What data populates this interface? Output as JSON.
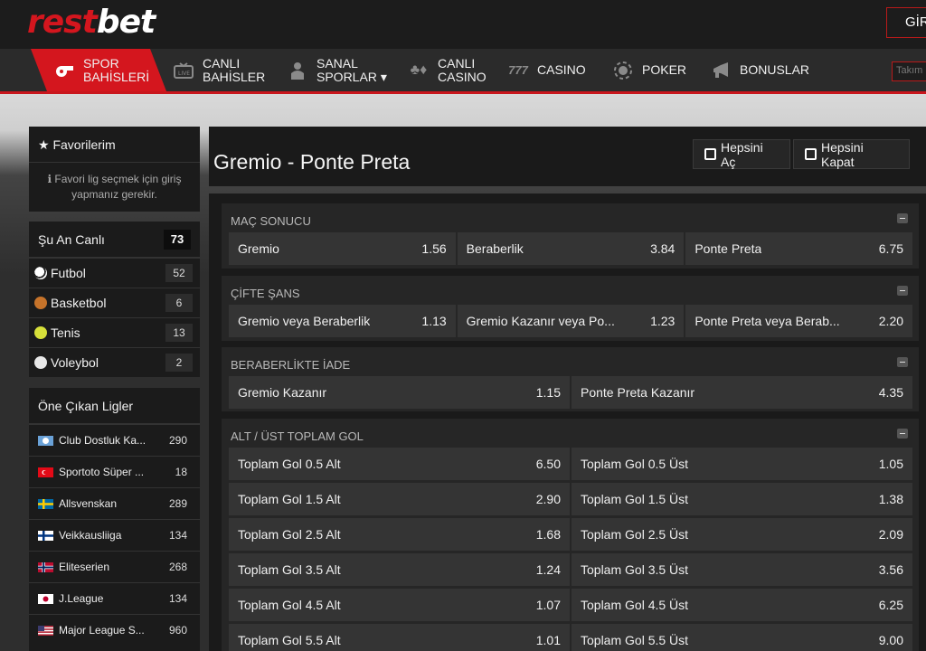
{
  "header": {
    "logo_rest": "rest",
    "logo_bet": "bet",
    "login_label": "GİRİ"
  },
  "nav": {
    "items": [
      {
        "line1": "SPOR",
        "line2": "BAHİSLERİ",
        "icon": "whistle-icon"
      },
      {
        "line1": "CANLI",
        "line2": "BAHİSLER",
        "icon": "live-tv-icon"
      },
      {
        "line1": "SANAL",
        "line2": "SPORLAR",
        "icon": "virtual-player-icon"
      },
      {
        "line1": "CANLI",
        "line2": "CASINO",
        "icon": "cards-icon"
      },
      {
        "line1": "CASINO",
        "line2": "",
        "icon": "slot-777-icon"
      },
      {
        "line1": "POKER",
        "line2": "",
        "icon": "poker-chip-icon"
      },
      {
        "line1": "BONUSLAR",
        "line2": "",
        "icon": "megaphone-icon"
      }
    ],
    "search_placeholder": "Takım"
  },
  "favorites": {
    "title": "★ Favorilerim",
    "note": "Favori lig seçmek için giriş yapmanız gerekir."
  },
  "live": {
    "title": "Şu An Canlı",
    "count": "73",
    "sports": [
      {
        "name": "Futbol",
        "count": "52"
      },
      {
        "name": "Basketbol",
        "count": "6"
      },
      {
        "name": "Tenis",
        "count": "13"
      },
      {
        "name": "Voleybol",
        "count": "2"
      }
    ]
  },
  "leagues": {
    "title": "Öne Çıkan Ligler",
    "items": [
      {
        "name": "Club Dostluk Ka...",
        "count": "290"
      },
      {
        "name": "Sportoto Süper ...",
        "count": "18"
      },
      {
        "name": "Allsvenskan",
        "count": "289"
      },
      {
        "name": "Veikkausliiga",
        "count": "134"
      },
      {
        "name": "Eliteserien",
        "count": "268"
      },
      {
        "name": "J.League",
        "count": "134"
      },
      {
        "name": "Major League S...",
        "count": "960"
      }
    ]
  },
  "match": {
    "title": "Gremio - Ponte Preta",
    "open_all": "Hepsini Aç",
    "close_all": "Hepsini Kapat"
  },
  "markets": [
    {
      "title": "MAÇ SONUCU",
      "rows": [
        [
          {
            "label": "Gremio",
            "odd": "1.56"
          },
          {
            "label": "Beraberlik",
            "odd": "3.84"
          },
          {
            "label": "Ponte Preta",
            "odd": "6.75"
          }
        ]
      ]
    },
    {
      "title": "ÇİFTE ŞANS",
      "rows": [
        [
          {
            "label": "Gremio veya Beraberlik",
            "odd": "1.13"
          },
          {
            "label": "Gremio Kazanır veya Po...",
            "odd": "1.23"
          },
          {
            "label": "Ponte Preta veya Berab...",
            "odd": "2.20"
          }
        ]
      ]
    },
    {
      "title": "BERABERLİKTE İADE",
      "rows": [
        [
          {
            "label": "Gremio Kazanır",
            "odd": "1.15"
          },
          {
            "label": "Ponte Preta Kazanır",
            "odd": "4.35"
          }
        ]
      ]
    },
    {
      "title": "ALT / ÜST TOPLAM GOL",
      "rows": [
        [
          {
            "label": "Toplam Gol 0.5 Alt",
            "odd": "6.50"
          },
          {
            "label": "Toplam Gol 0.5 Üst",
            "odd": "1.05"
          }
        ],
        [
          {
            "label": "Toplam Gol 1.5 Alt",
            "odd": "2.90"
          },
          {
            "label": "Toplam Gol 1.5 Üst",
            "odd": "1.38"
          }
        ],
        [
          {
            "label": "Toplam Gol 2.5 Alt",
            "odd": "1.68"
          },
          {
            "label": "Toplam Gol 2.5 Üst",
            "odd": "2.09"
          }
        ],
        [
          {
            "label": "Toplam Gol 3.5 Alt",
            "odd": "1.24"
          },
          {
            "label": "Toplam Gol 3.5 Üst",
            "odd": "3.56"
          }
        ],
        [
          {
            "label": "Toplam Gol 4.5 Alt",
            "odd": "1.07"
          },
          {
            "label": "Toplam Gol 4.5 Üst",
            "odd": "6.25"
          }
        ],
        [
          {
            "label": "Toplam Gol 5.5 Alt",
            "odd": "1.01"
          },
          {
            "label": "Toplam Gol 5.5 Üst",
            "odd": "9.00"
          }
        ]
      ]
    }
  ],
  "colors": {
    "accent": "#d4161e",
    "panel": "#1a1a1a",
    "odd_cell": "#343434"
  }
}
